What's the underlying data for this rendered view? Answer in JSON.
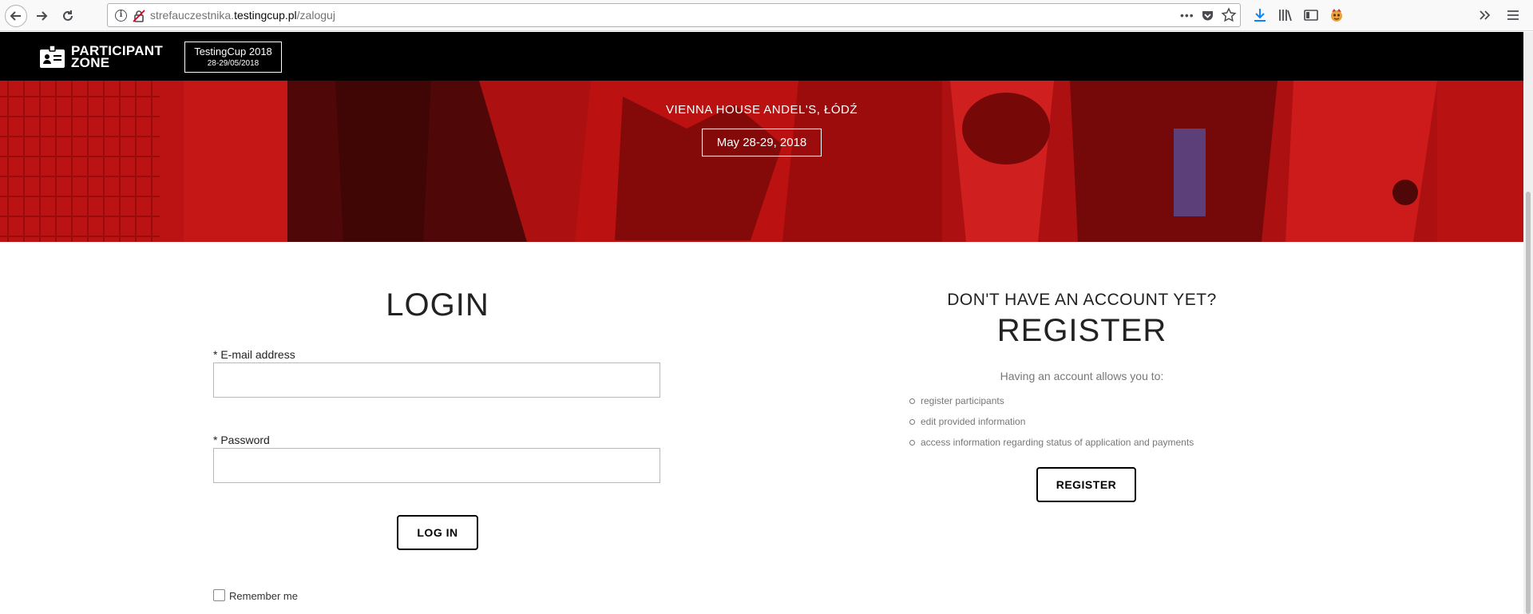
{
  "browser": {
    "url_prefix": "strefauczestnika.",
    "url_domain": "testingcup.pl",
    "url_path": "/zaloguj",
    "more_label": "•••"
  },
  "header": {
    "logo_line1": "PARTICIPANT",
    "logo_line2": "ZONE",
    "event_name": "TestingCup 2018",
    "event_dates": "28-29/05/2018"
  },
  "hero": {
    "venue": "VIENNA HOUSE ANDEL'S, ŁÓDŹ",
    "date": "May 28-29, 2018"
  },
  "login": {
    "title": "LOGIN",
    "email_label": "* E-mail address",
    "email_value": "",
    "password_label": "* Password",
    "password_value": "",
    "submit_label": "LOG IN",
    "remember_label": "Remember me"
  },
  "register": {
    "subtitle": "DON'T HAVE AN ACCOUNT YET?",
    "title": "REGISTER",
    "intro": "Having an account allows you to:",
    "items": [
      "register participants",
      "edit provided information",
      "access information regarding status of application and payments"
    ],
    "button_label": "REGISTER"
  },
  "colors": {
    "hero_tint": "#c41010",
    "header_bg": "#000000",
    "text": "#222222"
  }
}
